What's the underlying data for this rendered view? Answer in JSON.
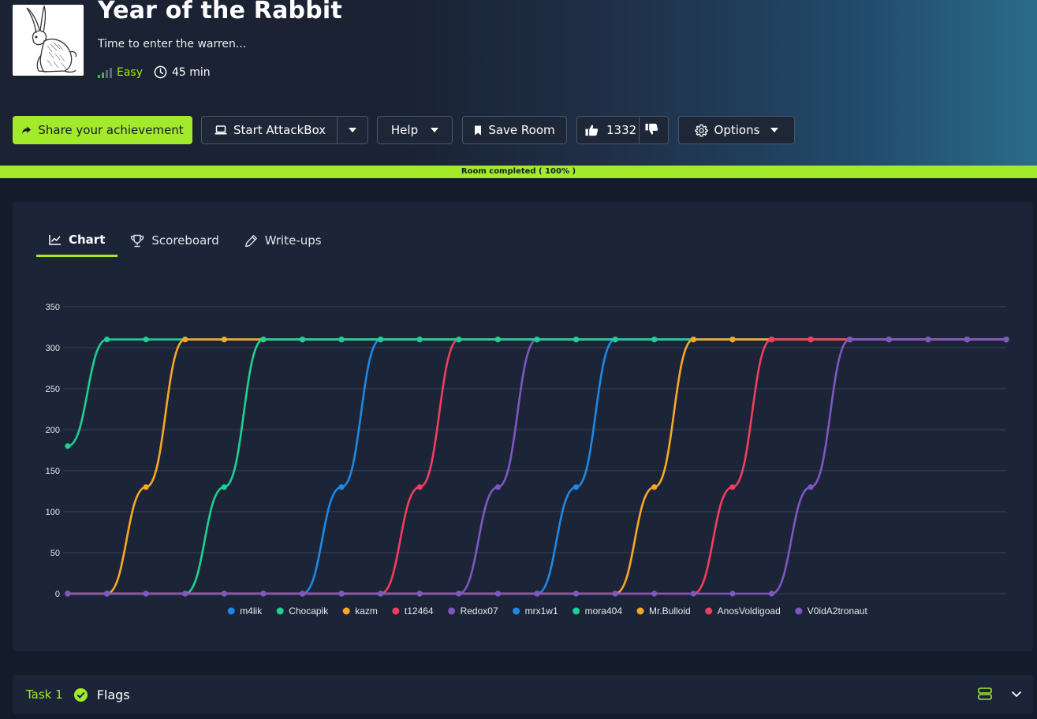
{
  "room": {
    "title": "Year of the Rabbit",
    "subtitle": "Time to enter the warren...",
    "difficulty": "Easy",
    "duration": "45 min",
    "thumbnail_icon": "rabbit-illustration"
  },
  "actions": {
    "share_label": "Share your achievement",
    "attackbox_label": "Start AttackBox",
    "help_label": "Help",
    "save_label": "Save Room",
    "likes_count": "1332",
    "options_label": "Options"
  },
  "progress": {
    "label": "Room completed ( 100% )",
    "percent": 100
  },
  "tabs": [
    {
      "label": "Chart",
      "icon": "line-chart-icon",
      "active": true
    },
    {
      "label": "Scoreboard",
      "icon": "trophy-icon",
      "active": false
    },
    {
      "label": "Write-ups",
      "icon": "pen-icon",
      "active": false
    }
  ],
  "chart_data": {
    "type": "line",
    "ylim": [
      0,
      350
    ],
    "yticks": [
      0,
      50,
      100,
      150,
      200,
      250,
      300,
      350
    ],
    "x_count": 25,
    "grid": true,
    "legend_position": "bottom",
    "series": [
      {
        "name": "m4lik",
        "color": "#1e88e5",
        "values": [
          0,
          0,
          0,
          0,
          0,
          0,
          0,
          130,
          310,
          310,
          310,
          310,
          310,
          310,
          310,
          310,
          310,
          310,
          310,
          310,
          310,
          310,
          310,
          310,
          310
        ]
      },
      {
        "name": "Chocapik",
        "color": "#1dd193",
        "values": [
          180,
          310,
          310,
          310,
          310,
          310,
          310,
          310,
          310,
          310,
          310,
          310,
          310,
          310,
          310,
          310,
          310,
          310,
          310,
          310,
          310,
          310,
          310,
          310,
          310
        ]
      },
      {
        "name": "kazm",
        "color": "#f9a826",
        "values": [
          0,
          0,
          130,
          310,
          310,
          310,
          310,
          310,
          310,
          310,
          310,
          310,
          310,
          310,
          310,
          310,
          310,
          310,
          310,
          310,
          310,
          310,
          310,
          310,
          310
        ]
      },
      {
        "name": "t12464",
        "color": "#f03e5e",
        "values": [
          0,
          0,
          0,
          0,
          0,
          0,
          0,
          0,
          0,
          130,
          310,
          310,
          310,
          310,
          310,
          310,
          310,
          310,
          310,
          310,
          310,
          310,
          310,
          310,
          310
        ]
      },
      {
        "name": "Redox07",
        "color": "#7e57c2",
        "values": [
          0,
          0,
          0,
          0,
          0,
          0,
          0,
          0,
          0,
          0,
          0,
          130,
          310,
          310,
          310,
          310,
          310,
          310,
          310,
          310,
          310,
          310,
          310,
          310,
          310
        ]
      },
      {
        "name": "mrx1w1",
        "color": "#1e88e5",
        "values": [
          0,
          0,
          0,
          0,
          0,
          0,
          0,
          0,
          0,
          0,
          0,
          0,
          0,
          130,
          310,
          310,
          310,
          310,
          310,
          310,
          310,
          310,
          310,
          310,
          310
        ]
      },
      {
        "name": "mora404",
        "color": "#1dd193",
        "values": [
          0,
          0,
          0,
          0,
          130,
          310,
          310,
          310,
          310,
          310,
          310,
          310,
          310,
          310,
          310,
          310,
          310,
          310,
          310,
          310,
          310,
          310,
          310,
          310,
          310
        ]
      },
      {
        "name": "Mr.Bulloid",
        "color": "#f9a826",
        "values": [
          0,
          0,
          0,
          0,
          0,
          0,
          0,
          0,
          0,
          0,
          0,
          0,
          0,
          0,
          0,
          130,
          310,
          310,
          310,
          310,
          310,
          310,
          310,
          310,
          310
        ]
      },
      {
        "name": "AnosVoldigoad",
        "color": "#f03e5e",
        "values": [
          0,
          0,
          0,
          0,
          0,
          0,
          0,
          0,
          0,
          0,
          0,
          0,
          0,
          0,
          0,
          0,
          0,
          130,
          310,
          310,
          310,
          310,
          310,
          310,
          310
        ]
      },
      {
        "name": "V0idA2tronaut",
        "color": "#7e57c2",
        "values": [
          0,
          0,
          0,
          0,
          0,
          0,
          0,
          0,
          0,
          0,
          0,
          0,
          0,
          0,
          0,
          0,
          0,
          0,
          0,
          130,
          310,
          310,
          310,
          310,
          310
        ]
      }
    ]
  },
  "task": {
    "number": "Task 1",
    "title": "Flags",
    "status_icon": "check-circle-icon"
  },
  "colors": {
    "accent": "#a3ea2a",
    "background": "#141c2b",
    "panel": "#1c2538"
  }
}
